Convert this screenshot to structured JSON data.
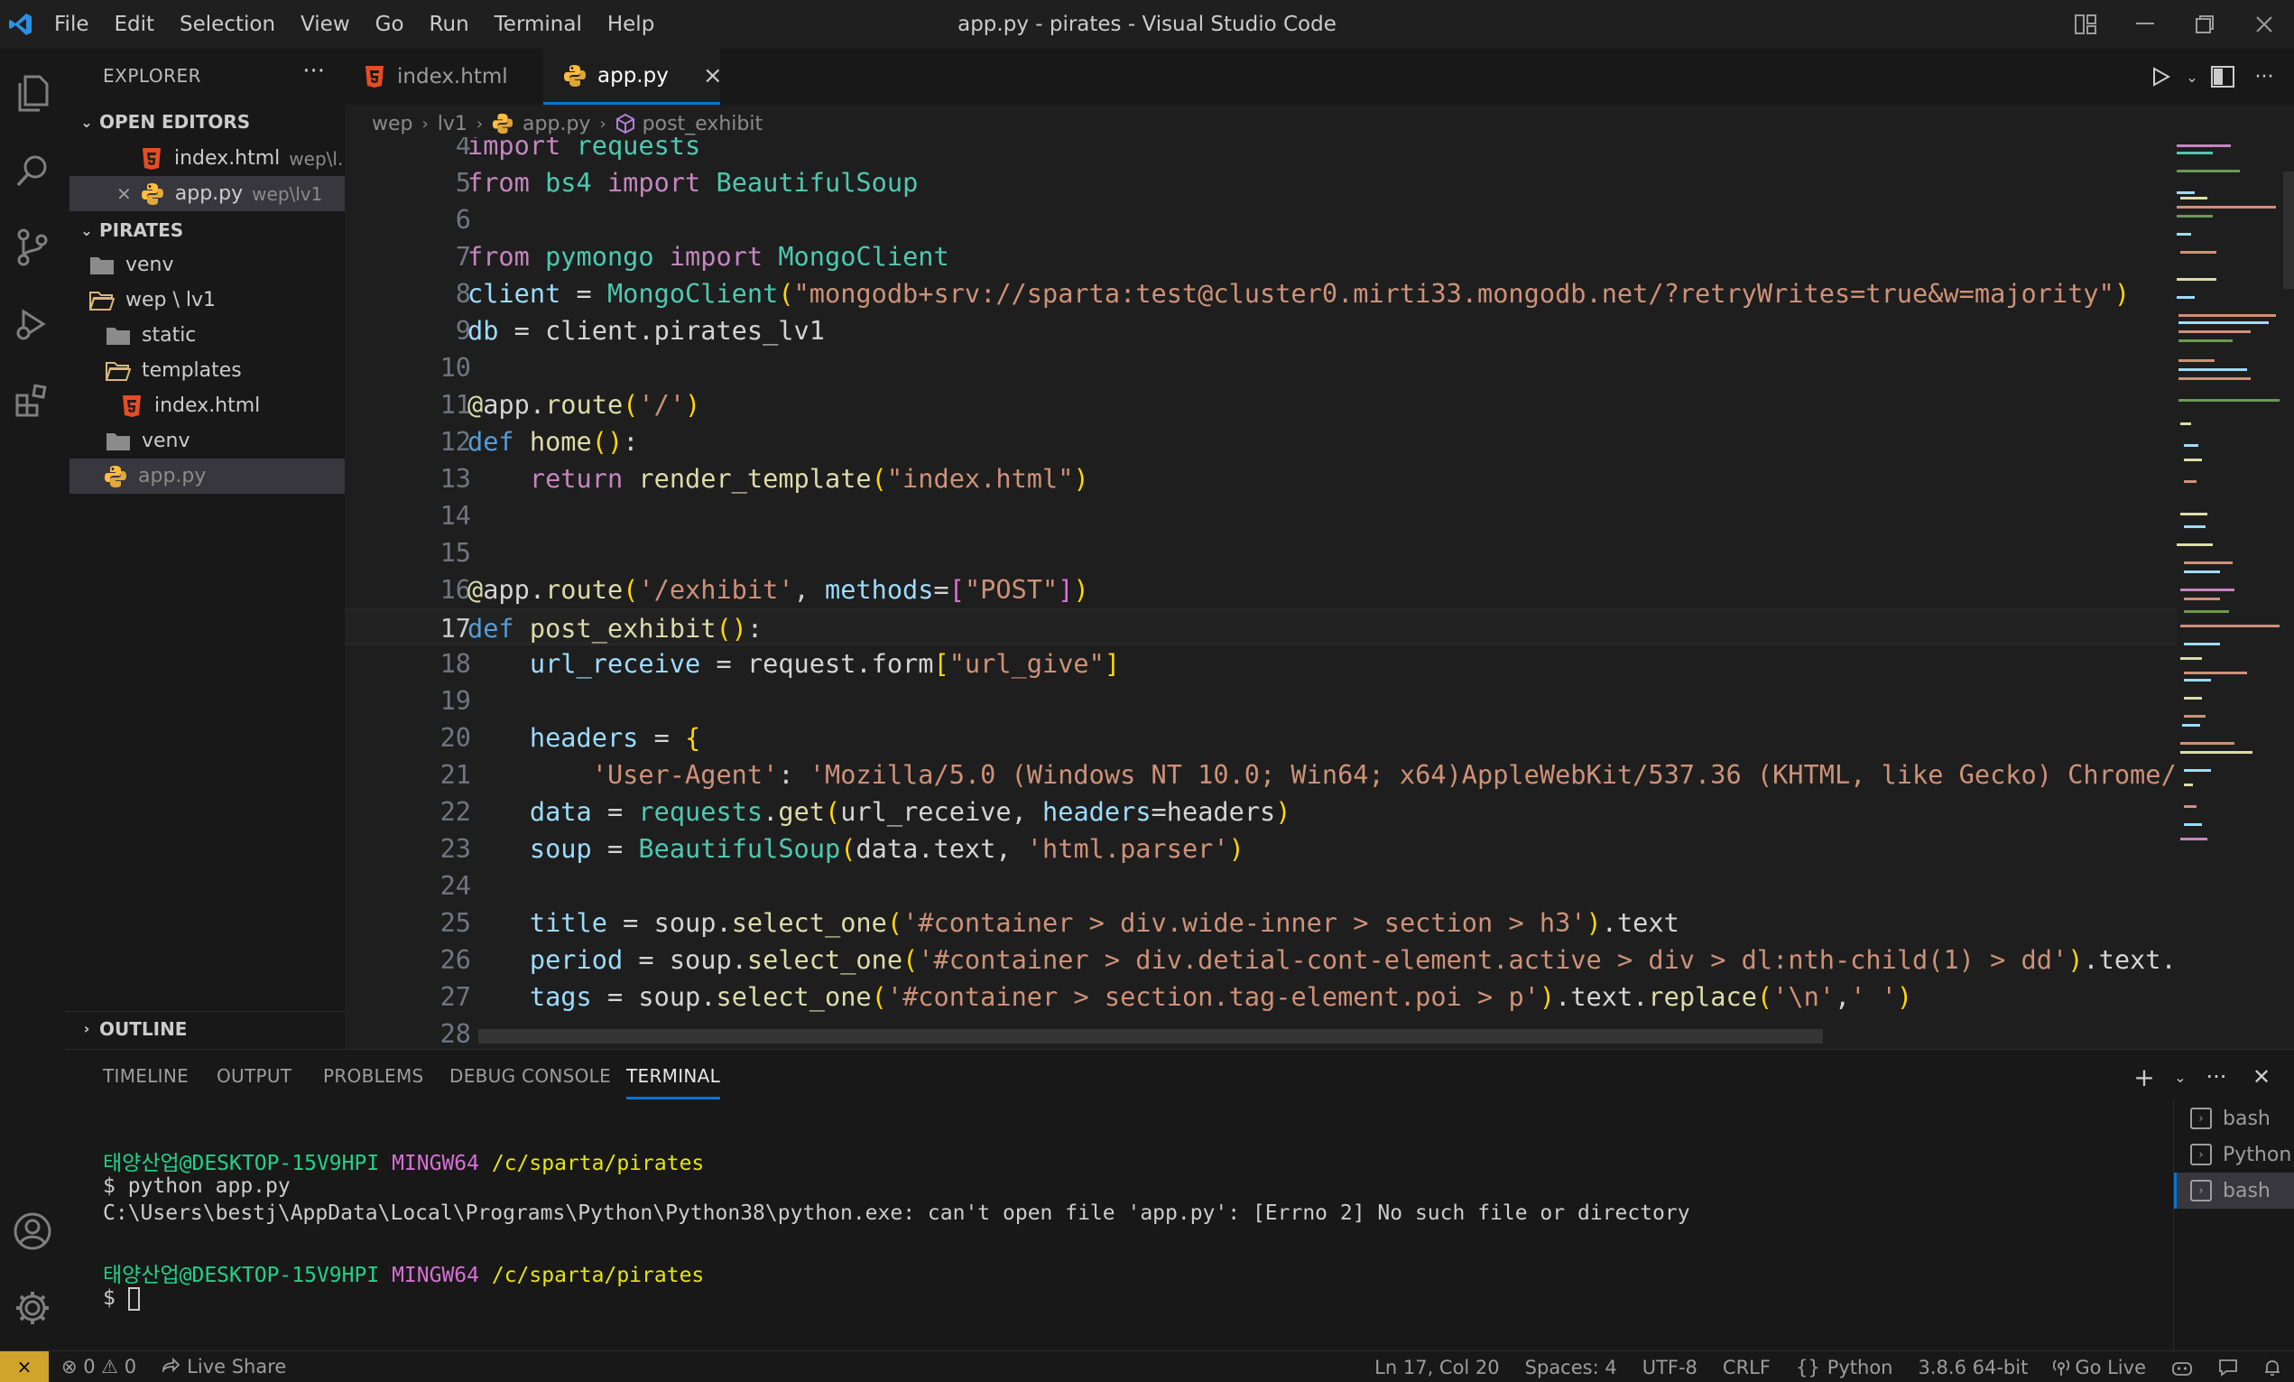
{
  "window": {
    "title": "app.py - pirates - Visual Studio Code",
    "menu": [
      "File",
      "Edit",
      "Selection",
      "View",
      "Go",
      "Run",
      "Terminal",
      "Help"
    ]
  },
  "sidebar": {
    "title": "EXPLORER",
    "more": "···",
    "open_editors_label": "OPEN EDITORS",
    "open_editors": [
      {
        "name": "index.html",
        "path": "wep\\l..."
      },
      {
        "name": "app.py",
        "path": "wep\\lv1"
      }
    ],
    "project_label": "PIRATES",
    "tree": [
      {
        "name": "venv"
      },
      {
        "name": "wep \\ lv1"
      },
      {
        "name": "static"
      },
      {
        "name": "templates"
      },
      {
        "name": "index.html"
      },
      {
        "name": "venv"
      },
      {
        "name": "app.py"
      }
    ],
    "outline_label": "OUTLINE"
  },
  "tabs": [
    {
      "label": "index.html"
    },
    {
      "label": "app.py",
      "close": "×"
    }
  ],
  "breadcrumb": [
    "wep",
    "lv1",
    "app.py",
    "post_exhibit"
  ],
  "editor": {
    "line_numbers": [
      "4",
      "5",
      "6",
      "7",
      "8",
      "9",
      "10",
      "11",
      "12",
      "13",
      "14",
      "15",
      "16",
      "17",
      "18",
      "19",
      "20",
      "21",
      "22",
      "23",
      "24",
      "25",
      "26",
      "27",
      "28"
    ],
    "current_line": "17"
  },
  "panel": {
    "tabs": [
      "TIMELINE",
      "OUTPUT",
      "PROBLEMS",
      "DEBUG CONSOLE",
      "TERMINAL"
    ],
    "terminal": {
      "user1": "태양산업@DESKTOP-15V9HPI",
      "env1": "MINGW64",
      "path1": "/c/sparta/pirates",
      "cmd": "$ python app.py",
      "error": "C:\\Users\\bestj\\AppData\\Local\\Programs\\Python\\Python38\\python.exe: can't open file 'app.py': [Errno 2] No such file or directory",
      "user2": "태양산업@DESKTOP-15V9HPI",
      "env2": "MINGW64",
      "path2": "/c/sparta/pirates",
      "prompt": "$ "
    },
    "terminals": [
      "bash",
      "Python",
      "bash"
    ]
  },
  "statusbar": {
    "remote": "×",
    "problems": "⊗ 0 ⚠ 0",
    "live_share": "Live Share",
    "position": "Ln 17, Col 20",
    "spaces": "Spaces: 4",
    "encoding": "UTF-8",
    "eol": "CRLF",
    "language": "Python",
    "interpreter": "3.8.6 64-bit",
    "go_live": "Go Live"
  }
}
